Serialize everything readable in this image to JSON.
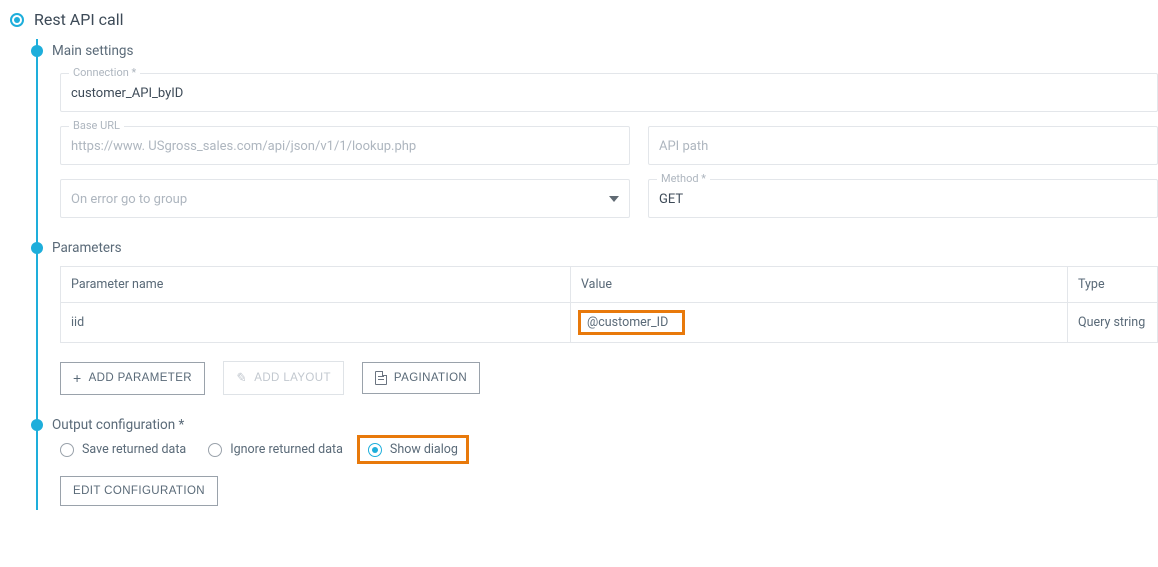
{
  "title": "Rest API call",
  "sections": {
    "main": {
      "title": "Main settings",
      "connection": {
        "label": "Connection *",
        "value": "customer_API_byID"
      },
      "base_url": {
        "label": "Base URL",
        "placeholder": "https://www. USgross_sales.com/api/json/v1/1/lookup.php"
      },
      "api_path": {
        "placeholder": "API path"
      },
      "on_error": {
        "value": "On error go to group"
      },
      "method": {
        "label": "Method *",
        "value": "GET"
      }
    },
    "params": {
      "title": "Parameters",
      "columns": {
        "name": "Parameter name",
        "value": "Value",
        "type": "Type"
      },
      "rows": [
        {
          "name": "iid",
          "value": "@customer_ID",
          "type": "Query string"
        }
      ],
      "buttons": {
        "add_param": "Add parameter",
        "add_layout": "Add layout",
        "pagination": "Pagination"
      }
    },
    "output": {
      "title": "Output configuration *",
      "options": {
        "save": "Save returned data",
        "ignore": "Ignore returned data",
        "show_dialog": "Show dialog"
      },
      "selected": "show_dialog",
      "edit_btn": "Edit configuration"
    }
  }
}
